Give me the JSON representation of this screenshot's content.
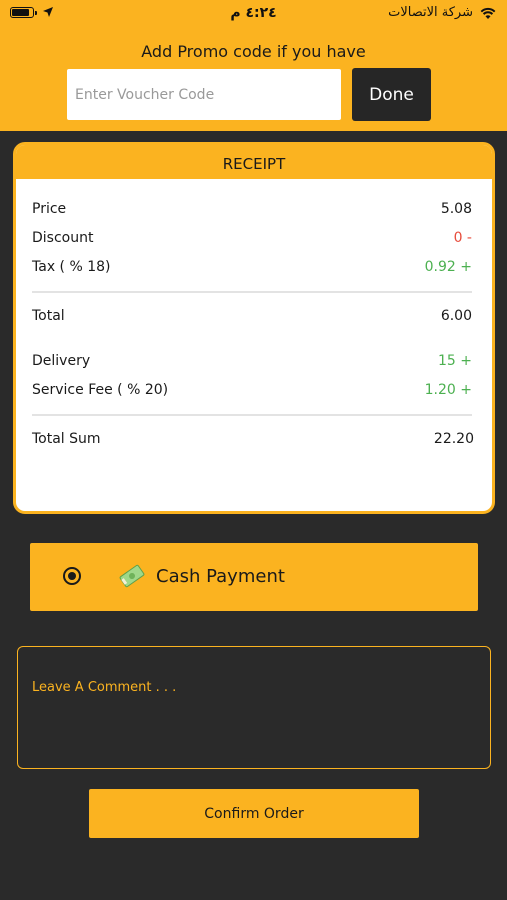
{
  "status_bar": {
    "time": "٤:٢٤ م",
    "carrier": "شركة الاتصالات"
  },
  "promo": {
    "title": "Add Promo code if you have",
    "voucher_placeholder": "Enter Voucher Code",
    "done_label": "Done"
  },
  "receipt": {
    "header": "RECEIPT",
    "rows": [
      {
        "label": "Price",
        "value": "5.08"
      },
      {
        "label": "Discount",
        "value": "0 -"
      },
      {
        "label": "Tax ( % 18)",
        "value": "0.92 +"
      },
      {
        "label": "Total",
        "value": "6.00"
      },
      {
        "label": "Delivery",
        "value": "15 +"
      },
      {
        "label": "Service Fee ( % 20)",
        "value": "1.20 +"
      },
      {
        "label": "Total Sum",
        "value": "22.20"
      }
    ]
  },
  "payment": {
    "method_label": "Cash Payment",
    "selected": true
  },
  "comment": {
    "placeholder": "Leave A Comment . . ."
  },
  "confirm_label": "Confirm Order",
  "colors": {
    "accent": "#fbb320",
    "background": "#2a2a2a",
    "negative": "#e74c3c",
    "positive": "#4cb050"
  }
}
